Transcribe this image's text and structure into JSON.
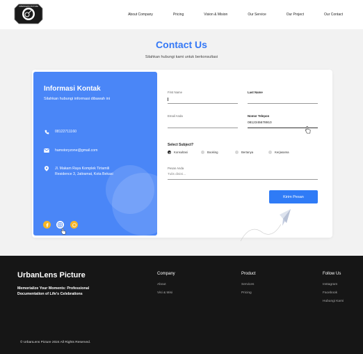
{
  "nav": {
    "logo_text": "URBANLENS PICTURE",
    "links": [
      "About Company",
      "Pricing",
      "Vision & Mision",
      "Our Service",
      "Our Project",
      "Our Contact"
    ]
  },
  "header": {
    "title": "Contact Us",
    "subtitle": "Silahkan hubungi kami untuk berkonsultasi"
  },
  "info": {
    "title": "Informasi Kontak",
    "subtitle": "Silahkan hubungi informasi dibawah ini",
    "phone": "08122711160",
    "email": "hamstoryzone@gmail.com",
    "address": "Jl. Makam Raya Komplek Tirtamili Residence 3, Jatiramat, Kota Bekasi"
  },
  "form": {
    "first_name_label": "First Name",
    "last_name_label": "Last Name",
    "email_label": "Email Anda",
    "phone_label": "Nomor Telepon",
    "phone_value": "0812345678910",
    "select_title": "Select Subject?",
    "options": [
      "Konsultasi",
      "Booking",
      "Bertanya",
      "Kerjasama"
    ],
    "selected": "Konsultasi",
    "message_label": "Pesan Anda",
    "message_placeholder": "Tulis disini...",
    "submit": "Kirim Pesan"
  },
  "footer": {
    "brand": "UrbanLens Picture",
    "tagline": "Memorialize Your Moments: Professional Documentation of Life's Celebrations",
    "company": {
      "title": "Company",
      "items": [
        "About",
        "Visi & Misi"
      ]
    },
    "product": {
      "title": "Product",
      "items": [
        "Services",
        "Pricing"
      ]
    },
    "follow": {
      "title": "Follow Us",
      "items": [
        "Instagram",
        "Facebook",
        "Hubungi Kami"
      ]
    },
    "copyright": "© UrbanLens Picture 2024 All Rights Reserved."
  },
  "colors": {
    "accent": "#3478f6",
    "info_panel": "#4a86f7",
    "social": "#f6b626",
    "footer_bg": "#161616"
  },
  "icons": [
    "logo-badge",
    "phone-icon",
    "mail-icon",
    "location-icon",
    "facebook-icon",
    "instagram-icon",
    "whatsapp-icon",
    "paper-plane-icon",
    "hand-cursor-icon"
  ]
}
